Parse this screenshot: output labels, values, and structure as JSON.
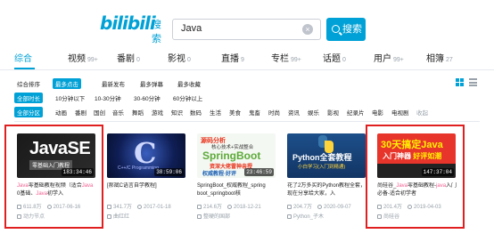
{
  "header": {
    "logo_text": "bilibili",
    "logo_sub": "搜索",
    "search_value": "Java",
    "search_button": "搜索"
  },
  "tabs": [
    {
      "label": "综合",
      "count": ""
    },
    {
      "label": "视频",
      "count": "99+"
    },
    {
      "label": "番剧",
      "count": "0"
    },
    {
      "label": "影视",
      "count": "0"
    },
    {
      "label": "直播",
      "count": "9"
    },
    {
      "label": "专栏",
      "count": "99+"
    },
    {
      "label": "话题",
      "count": "0"
    },
    {
      "label": "用户",
      "count": "99+"
    },
    {
      "label": "相簿",
      "count": "27"
    }
  ],
  "sort": [
    "综合排序",
    "最多点击",
    "最新发布",
    "最多弹幕",
    "最多收藏"
  ],
  "durations": [
    "全部时长",
    "10分钟以下",
    "10-30分钟",
    "30-60分钟",
    "60分钟以上"
  ],
  "partitions": [
    "全部分区",
    "动画",
    "番剧",
    "国创",
    "音乐",
    "舞蹈",
    "游戏",
    "知识",
    "数码",
    "生活",
    "美食",
    "鬼畜",
    "时尚",
    "资讯",
    "娱乐",
    "影视",
    "纪录片",
    "电影",
    "电视剧",
    "收起"
  ],
  "videos": [
    {
      "thumb_title": "JavaSE",
      "thumb_sub": "零基础入门教程",
      "duration": "183:34:46",
      "title_hl": "Java",
      "title_rest": "零基础教程视频（适合",
      "title_hl2": "Java",
      "title_rest2": " 0基础、",
      "title_hl3": "Java",
      "title_rest3": "初学入",
      "views": "611.8万",
      "date": "2017-06-16",
      "uploader": "动力节点"
    },
    {
      "thumb_title": "C",
      "thumb_sub": "C++/C Programming",
      "duration": "38:59:06",
      "title": "[郝斌C语言自学教程]",
      "views": "341.7万",
      "date": "2017-01-18",
      "uploader": "曲红红"
    },
    {
      "thumb_top": "源码分析",
      "thumb_mid": "核心技术+实战整合",
      "thumb_title": "SpringBoot",
      "thumb_bot": "资深大佬雷神亲授",
      "thumb_bot2": "权威教程·好评",
      "duration": "23:46:59",
      "title": "SpringBoot_权威教程_spring boot_springboot核",
      "views": "214.6万",
      "date": "2018-12-21",
      "uploader": "整硬的国部"
    },
    {
      "thumb_title": "Python全套教程",
      "thumb_sub": "小白学习(入门到精通)",
      "duration": "",
      "title": "花了2万多买的Python教程全套，现在分享给大家，入",
      "views": "204.7万",
      "date": "2020-09-07",
      "uploader": "Python_子木"
    },
    {
      "thumb_title": "30天搞定Java",
      "thumb_l2a": "入门神器",
      "thumb_l2b": "好评如潮",
      "duration": "147:37:04",
      "title_a": "尚硅谷_",
      "title_hl": "Java",
      "title_b": "零基础教程-",
      "title_hl2": "java",
      "title_c": "入门必备-适合初学者",
      "views": "201.4万",
      "date": "2019-04-03",
      "uploader": "尚硅谷"
    }
  ],
  "colors": {
    "accent": "#00a1d6",
    "highlight": "#f25d8e",
    "annotation_box": "#e02020"
  }
}
